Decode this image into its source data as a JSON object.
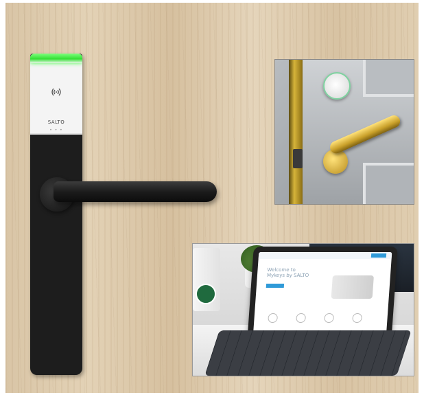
{
  "lock": {
    "brand": "SALTO",
    "rfid_icon": "rfid-waves-icon",
    "led_color": "#35e035"
  },
  "photo_door": {
    "lever_color": "#c9a02a",
    "reader_ring_color": "#7fd2a0"
  },
  "photo_tablet": {
    "screen_title": "Welcome to\nMykeys by SALTO",
    "accent": "#2f9ad8"
  }
}
